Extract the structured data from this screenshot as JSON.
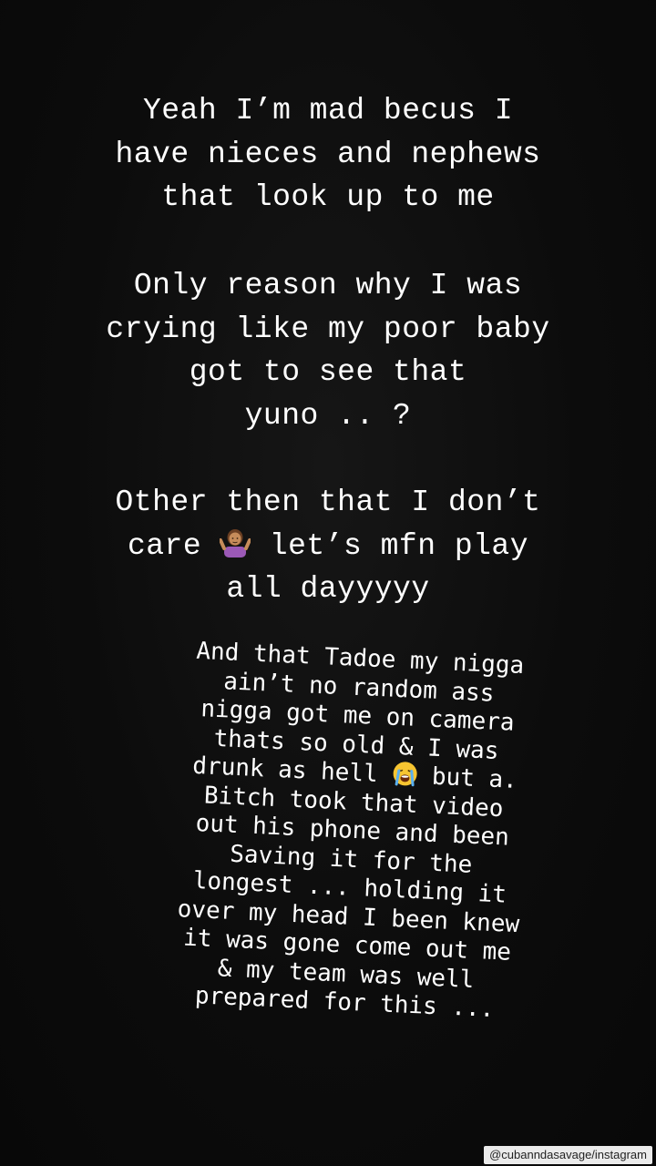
{
  "story": {
    "paragraph_1": {
      "lines": [
        "Yeah I’m mad becus I",
        "have nieces and nephews",
        "that look up to me"
      ]
    },
    "paragraph_2": {
      "lines": [
        "Only reason why I was",
        "crying like my poor baby",
        "got to see that",
        "yuno .. ?"
      ]
    },
    "paragraph_3": {
      "line_1": "Other then that I don’t",
      "line_2_before_emoji": "care ",
      "line_2_emoji": "person-shrugging-emoji",
      "line_2_after_emoji": " let’s mfn play",
      "line_3": "all dayyyyy"
    },
    "paragraph_4": {
      "lines_before": [
        "And that Tadoe my nigga",
        "ain’t no random ass",
        "nigga got me on camera",
        "thats so old & I was"
      ],
      "line_emoji_before": "drunk as hell ",
      "line_emoji": "loudly-crying-face-emoji",
      "line_emoji_after": " but a.",
      "lines_after": [
        "Bitch took that video",
        "out his phone and been",
        "Saving it for the",
        "longest ... holding it",
        "over my head I been knew",
        "it was gone come out me",
        "& my team was well",
        "prepared for this ..."
      ]
    }
  },
  "watermark": "@cubanndasavage/instagram",
  "colors": {
    "background": "#0a0a0a",
    "text": "#ffffff"
  }
}
